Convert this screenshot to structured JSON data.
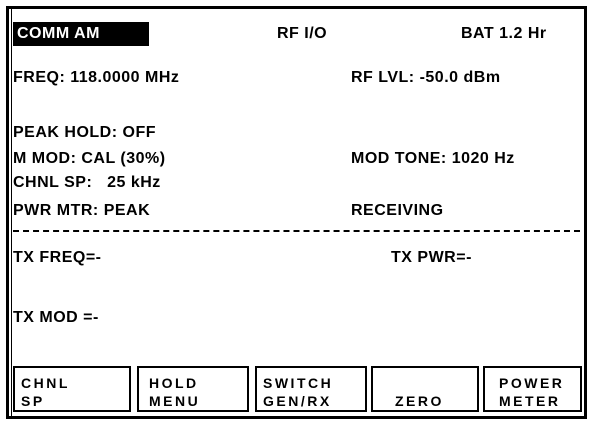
{
  "status_bar": {
    "mode": "COMM AM",
    "rf_io": "RF I/O",
    "battery": "BAT  1.2 Hr"
  },
  "readings": {
    "freq": "FREQ: 118.0000 MHz",
    "rf_lvl": "RF LVL: -50.0 dBm",
    "peak_hold": "PEAK HOLD: OFF",
    "m_mod": "M MOD: CAL (30%)",
    "mod_tone": "MOD TONE: 1020 Hz",
    "chnl_sp": "CHNL SP:   25 kHz",
    "pwr_mtr": "PWR MTR: PEAK",
    "state": "RECEIVING"
  },
  "tx": {
    "freq": "TX FREQ=-",
    "pwr": "TX PWR=-",
    "mod": "TX MOD =-"
  },
  "softkeys": [
    {
      "line1": "CHNL",
      "line2": "SP"
    },
    {
      "line1": "HOLD",
      "line2": "MENU"
    },
    {
      "line1": "SWITCH",
      "line2": "GEN/RX"
    },
    {
      "line1": "",
      "line2": "ZERO"
    },
    {
      "line1": "POWER",
      "line2": "METER"
    }
  ]
}
